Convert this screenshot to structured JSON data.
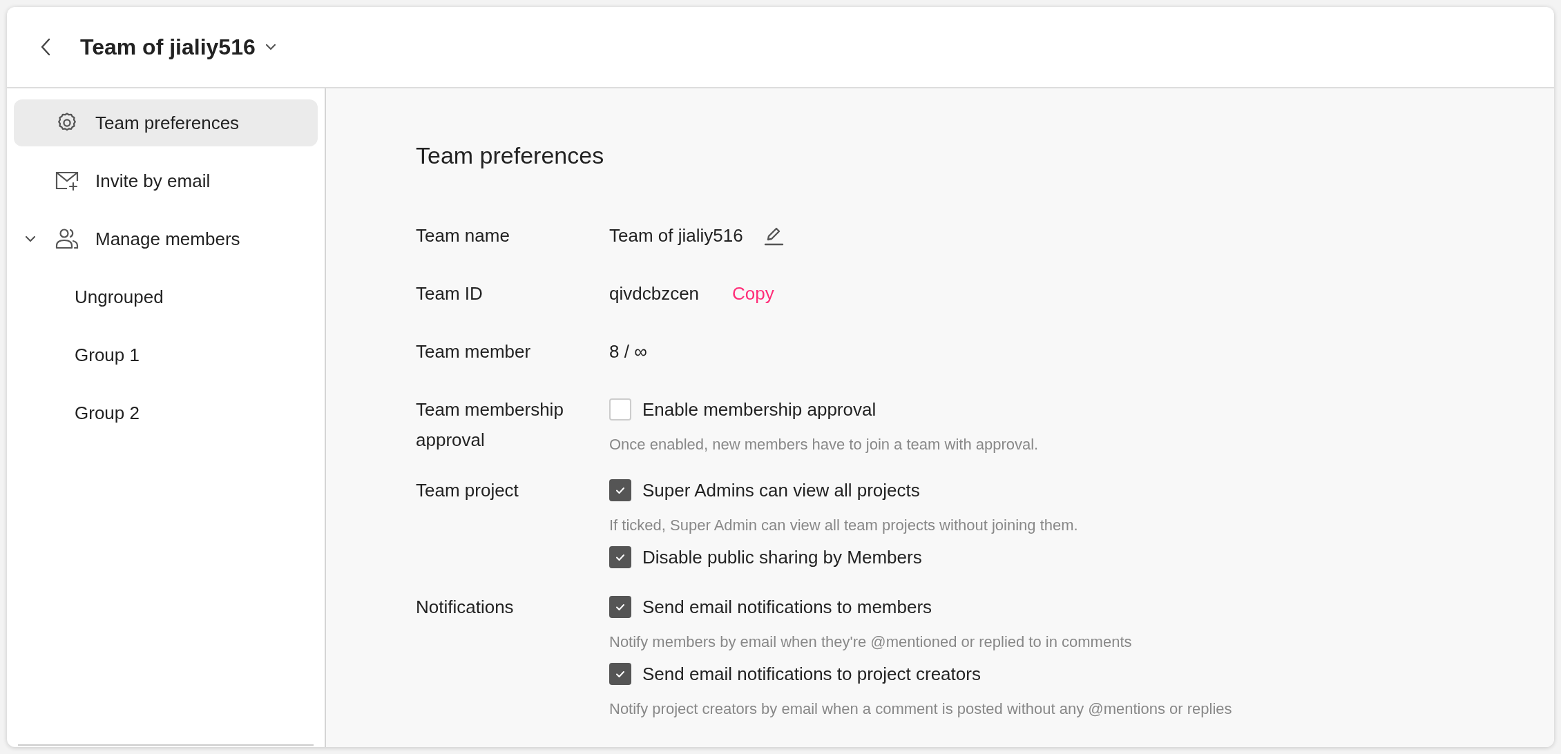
{
  "header": {
    "title": "Team of jialiy516"
  },
  "sidebar": {
    "items": [
      {
        "label": "Team preferences",
        "kind": "gear",
        "selected": true
      },
      {
        "label": "Invite by email",
        "kind": "mail",
        "selected": false
      },
      {
        "label": "Manage members",
        "kind": "people",
        "selected": false,
        "expanded": true,
        "children": [
          {
            "label": "Ungrouped",
            "selected": false
          },
          {
            "label": "Group 1",
            "selected": false
          },
          {
            "label": "Group 2",
            "selected": false
          }
        ]
      }
    ]
  },
  "main": {
    "title": "Team preferences",
    "fields": [
      {
        "kind": "editable",
        "label": "Team name",
        "value": "Team of jialiy516"
      },
      {
        "kind": "copyable",
        "label": "Team ID",
        "value": "qivdcbzcen",
        "action": "Copy"
      },
      {
        "kind": "plain",
        "label": "Team member",
        "value": "8 / ∞"
      },
      {
        "kind": "options",
        "label": "Team membership approval",
        "options": [
          {
            "label": "Enable membership approval",
            "checked": false,
            "hint": "Once enabled, new members have to join a team with approval."
          }
        ]
      },
      {
        "kind": "options",
        "label": "Team project",
        "options": [
          {
            "label": "Super Admins can view all projects",
            "checked": true,
            "hint": "If ticked, Super Admin can view all team projects without joining them."
          },
          {
            "label": "Disable public sharing by Members",
            "checked": true
          }
        ]
      },
      {
        "kind": "options",
        "label": "Notifications",
        "options": [
          {
            "label": "Send email notifications to members",
            "checked": true,
            "hint": "Notify members by email when they're @mentioned or replied to in comments"
          },
          {
            "label": "Send email notifications to project creators",
            "checked": true,
            "hint": "Notify project creators by email when a comment is posted without any @mentions or replies"
          }
        ]
      }
    ]
  }
}
